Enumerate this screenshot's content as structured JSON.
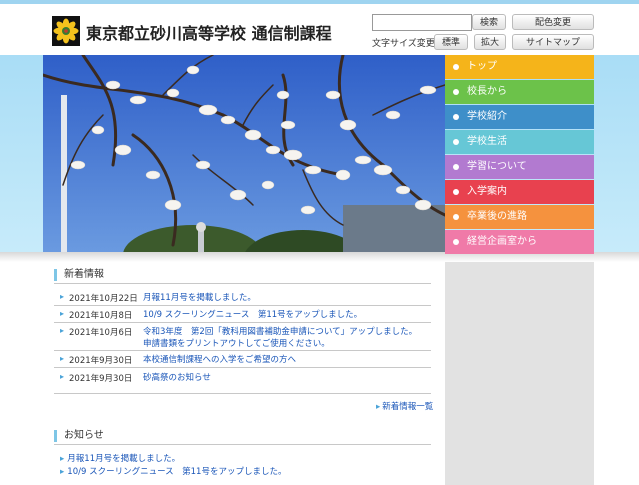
{
  "header": {
    "title": "東京都立砂川高等学校 通信制課程",
    "logo_icon": "school-crest-icon",
    "search_button": "検索",
    "color_button": "配色変更",
    "fontsize_label": "文字サイズ変更",
    "fontsize_standard": "標準",
    "fontsize_large": "拡大",
    "sitemap_button": "サイトマップ"
  },
  "nav": [
    {
      "label": "トップ",
      "color": "#f5b41a"
    },
    {
      "label": "校長から",
      "color": "#6cc24a"
    },
    {
      "label": "学校紹介",
      "color": "#3e8fc9"
    },
    {
      "label": "学校生活",
      "color": "#66c7d6"
    },
    {
      "label": "学習について",
      "color": "#b27ad0"
    },
    {
      "label": "入学案内",
      "color": "#e8414f"
    },
    {
      "label": "卒業後の進路",
      "color": "#f5923e"
    },
    {
      "label": "経営企画室から",
      "color": "#f07aa8"
    }
  ],
  "news": {
    "heading": "新着情報",
    "items": [
      {
        "date": "2021年10月22日",
        "title": "月報11月号を掲載しました。"
      },
      {
        "date": "2021年10月8日",
        "title": "10/9 スクーリングニュース　第11号をアップしました。"
      },
      {
        "date": "2021年10月6日",
        "title": "令和3年度　第2回「教科用図書補助金申請について」アップしました。申請書類をプリントアウトしてご使用ください。"
      },
      {
        "date": "2021年9月30日",
        "title": "本校通信制課程への入学をご希望の方へ"
      },
      {
        "date": "2021年9月30日",
        "title": "砂高祭のお知らせ"
      }
    ],
    "more_link": "新着情報一覧"
  },
  "notices": {
    "heading": "お知らせ",
    "items": [
      {
        "title": "月報11月号を掲載しました。"
      },
      {
        "title": "10/9 スクーリングニュース　第11号をアップしました。"
      }
    ]
  },
  "colors": {
    "accent_blue": "#7ec6e6",
    "link": "#1a56b8"
  }
}
